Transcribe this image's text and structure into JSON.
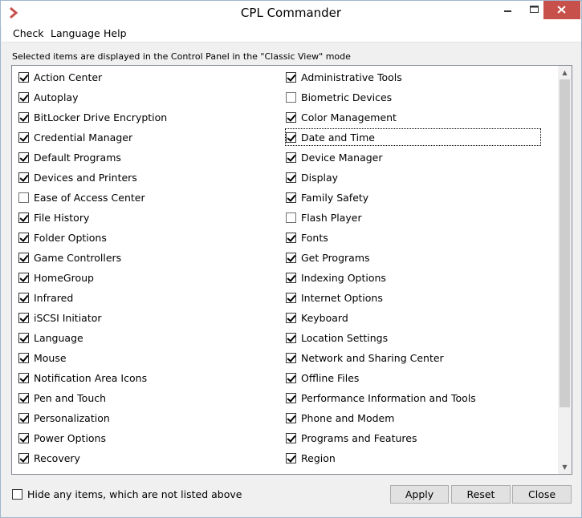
{
  "window": {
    "title": "CPL Commander",
    "accent_color": "#c7504a",
    "icon": "chevron-right-icon"
  },
  "menu": {
    "items": [
      "Check",
      "Language",
      "Help"
    ]
  },
  "info_text": "Selected items are displayed in the Control Panel in the \"Classic View\" mode",
  "list": {
    "left_column": [
      {
        "label": "Action Center",
        "checked": true
      },
      {
        "label": "Autoplay",
        "checked": true
      },
      {
        "label": "BitLocker Drive Encryption",
        "checked": true
      },
      {
        "label": "Credential Manager",
        "checked": true
      },
      {
        "label": "Default Programs",
        "checked": true
      },
      {
        "label": "Devices and Printers",
        "checked": true
      },
      {
        "label": "Ease of Access Center",
        "checked": false
      },
      {
        "label": "File History",
        "checked": true
      },
      {
        "label": "Folder Options",
        "checked": true
      },
      {
        "label": "Game Controllers",
        "checked": true
      },
      {
        "label": "HomeGroup",
        "checked": true
      },
      {
        "label": "Infrared",
        "checked": true
      },
      {
        "label": "iSCSI Initiator",
        "checked": true
      },
      {
        "label": "Language",
        "checked": true
      },
      {
        "label": "Mouse",
        "checked": true
      },
      {
        "label": "Notification Area Icons",
        "checked": true
      },
      {
        "label": "Pen and Touch",
        "checked": true
      },
      {
        "label": "Personalization",
        "checked": true
      },
      {
        "label": "Power Options",
        "checked": true
      },
      {
        "label": "Recovery",
        "checked": true
      }
    ],
    "right_column": [
      {
        "label": "Administrative Tools",
        "checked": true
      },
      {
        "label": "Biometric Devices",
        "checked": false
      },
      {
        "label": "Color Management",
        "checked": true
      },
      {
        "label": "Date and Time",
        "checked": true,
        "focused": true
      },
      {
        "label": "Device Manager",
        "checked": true
      },
      {
        "label": "Display",
        "checked": true
      },
      {
        "label": "Family Safety",
        "checked": true
      },
      {
        "label": "Flash Player",
        "checked": false
      },
      {
        "label": "Fonts",
        "checked": true
      },
      {
        "label": "Get Programs",
        "checked": true
      },
      {
        "label": "Indexing Options",
        "checked": true
      },
      {
        "label": "Internet Options",
        "checked": true
      },
      {
        "label": "Keyboard",
        "checked": true
      },
      {
        "label": "Location Settings",
        "checked": true
      },
      {
        "label": "Network and Sharing Center",
        "checked": true
      },
      {
        "label": "Offline Files",
        "checked": true
      },
      {
        "label": "Performance Information and Tools",
        "checked": true
      },
      {
        "label": "Phone and Modem",
        "checked": true
      },
      {
        "label": "Programs and Features",
        "checked": true
      },
      {
        "label": "Region",
        "checked": true
      }
    ]
  },
  "hide_unlisted": {
    "label": "Hide any items, which are not listed above",
    "checked": false
  },
  "buttons": {
    "apply": "Apply",
    "reset": "Reset",
    "close": "Close"
  }
}
